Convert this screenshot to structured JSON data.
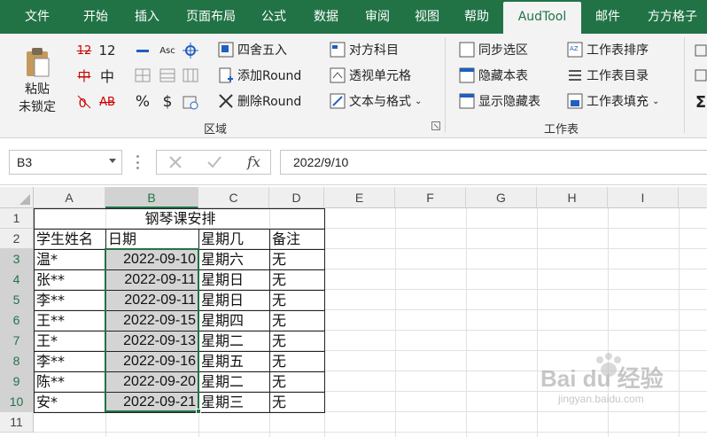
{
  "tabs": [
    "文件",
    "开始",
    "插入",
    "页面布局",
    "公式",
    "数据",
    "审阅",
    "视图",
    "帮助",
    "AudTool",
    "邮件",
    "方方格子"
  ],
  "ribbon": {
    "paste_label": "粘贴",
    "paste_sub": "未锁定",
    "region_buttons": [
      "四舍五入",
      "添加Round",
      "删除Round"
    ],
    "mid_buttons": [
      "对方科目",
      "透视单元格",
      "文本与格式"
    ],
    "group_region": "区域",
    "ws_buttons": [
      "同步选区",
      "隐藏本表",
      "显示隐藏表"
    ],
    "ws_buttons2": [
      "工作表排序",
      "工作表目录",
      "工作表填充"
    ],
    "group_worksheet": "工作表",
    "small_glyphs": [
      "12",
      "中",
      "AB",
      "Asc",
      "%",
      "$"
    ]
  },
  "formula_bar": {
    "name_box": "B3",
    "value": "2022/9/10",
    "fx": "fx"
  },
  "grid": {
    "columns": [
      "A",
      "B",
      "C",
      "D",
      "E",
      "F",
      "G",
      "H",
      "I"
    ],
    "rows": [
      "1",
      "2",
      "3",
      "4",
      "5",
      "6",
      "7",
      "8",
      "9",
      "10",
      "11"
    ],
    "title": "钢琴课安排",
    "headers": [
      "学生姓名",
      "日期",
      "星期几",
      "备注"
    ],
    "records": [
      [
        "温*",
        "2022-09-10",
        "星期六",
        "无"
      ],
      [
        "张**",
        "2022-09-11",
        "星期日",
        "无"
      ],
      [
        "李**",
        "2022-09-11",
        "星期日",
        "无"
      ],
      [
        "王**",
        "2022-09-15",
        "星期四",
        "无"
      ],
      [
        "王*",
        "2022-09-13",
        "星期二",
        "无"
      ],
      [
        "李**",
        "2022-09-16",
        "星期五",
        "无"
      ],
      [
        "陈**",
        "2022-09-20",
        "星期二",
        "无"
      ],
      [
        "安*",
        "2022-09-21",
        "星期三",
        "无"
      ]
    ]
  },
  "watermark": {
    "brand": "Bai du 经验",
    "url": "jingyan.baidu.com"
  },
  "colors": {
    "accent": "#217346",
    "selection_fill": "#d4d4d4"
  }
}
